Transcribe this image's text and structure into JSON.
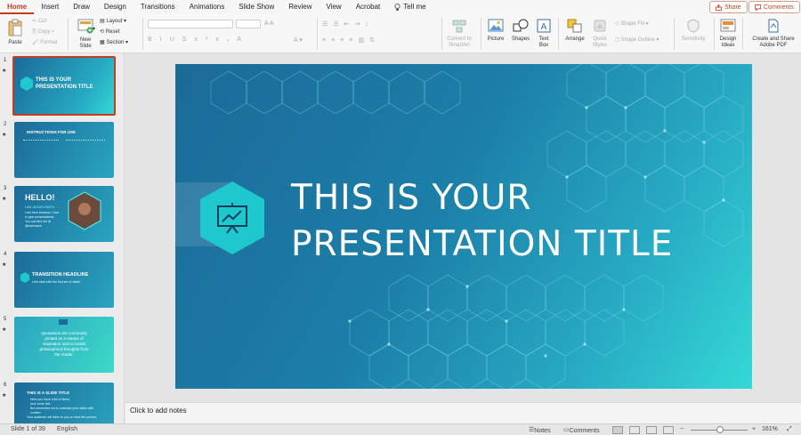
{
  "tabs": [
    "Home",
    "Insert",
    "Draw",
    "Design",
    "Transitions",
    "Animations",
    "Slide Show",
    "Review",
    "View",
    "Acrobat"
  ],
  "tell_me": "Tell me",
  "share_label": "Share",
  "comments_label": "Comments",
  "ribbon": {
    "paste": "Paste",
    "cut": "Cut",
    "copy": "Copy",
    "format": "Format",
    "new_slide_1": "New",
    "new_slide_2": "Slide",
    "layout": "Layout",
    "reset": "Reset",
    "section": "Section",
    "convert_1": "Convert to",
    "convert_2": "SmartArt",
    "picture": "Picture",
    "shapes": "Shapes",
    "textbox_1": "Text",
    "textbox_2": "Box",
    "arrange": "Arrange",
    "quick_1": "Quick",
    "quick_2": "Styles",
    "shape_fill": "Shape Fill",
    "shape_outline": "Shape Outline",
    "sensitivity": "Sensitivity",
    "design_1": "Design",
    "design_2": "Ideas",
    "create_1": "Create and Share",
    "create_2": "Adobe PDF"
  },
  "slides": [
    {
      "num": "1",
      "title_1": "THIS IS YOUR",
      "title_2": "PRESENTATION TITLE"
    },
    {
      "num": "2",
      "title": "INSTRUCTIONS FOR USE"
    },
    {
      "num": "3",
      "title": "HELLO!",
      "sub": "I AM JAYDEN SMITH",
      "l1": "I am here because I love",
      "l2": "to give presentations.",
      "l3": "You can find me at",
      "l4": "@username"
    },
    {
      "num": "4",
      "title": "TRANSITION HEADLINE",
      "sub": "Let's start with the first set of slides"
    },
    {
      "num": "5",
      "q1": "Quotations are commonly",
      "q2": "printed as a means of",
      "q3": "inspiration and to invoke",
      "q4": "philosophical thoughts from",
      "q5": "the reader."
    },
    {
      "num": "6",
      "title": "THIS IS A SLIDE TITLE",
      "b1": "Here you have a list of items",
      "b2": "And some text",
      "b3": "But remember not to overload your slides with",
      "b4": "content",
      "b5": "Your audience will listen to you or read the content,"
    }
  ],
  "main_slide": {
    "title_line1": "THIS IS YOUR",
    "title_line2": "PRESENTATION TITLE"
  },
  "notes_placeholder": "Click to add notes",
  "status": {
    "slide_of": "Slide 1 of 39",
    "language": "English",
    "notes": "Notes",
    "comments": "Comments",
    "zoom": "161%"
  },
  "colors": {
    "accent": "#c43e1c",
    "slide_dark": "#1b6a98",
    "slide_light": "#34d9d6"
  }
}
